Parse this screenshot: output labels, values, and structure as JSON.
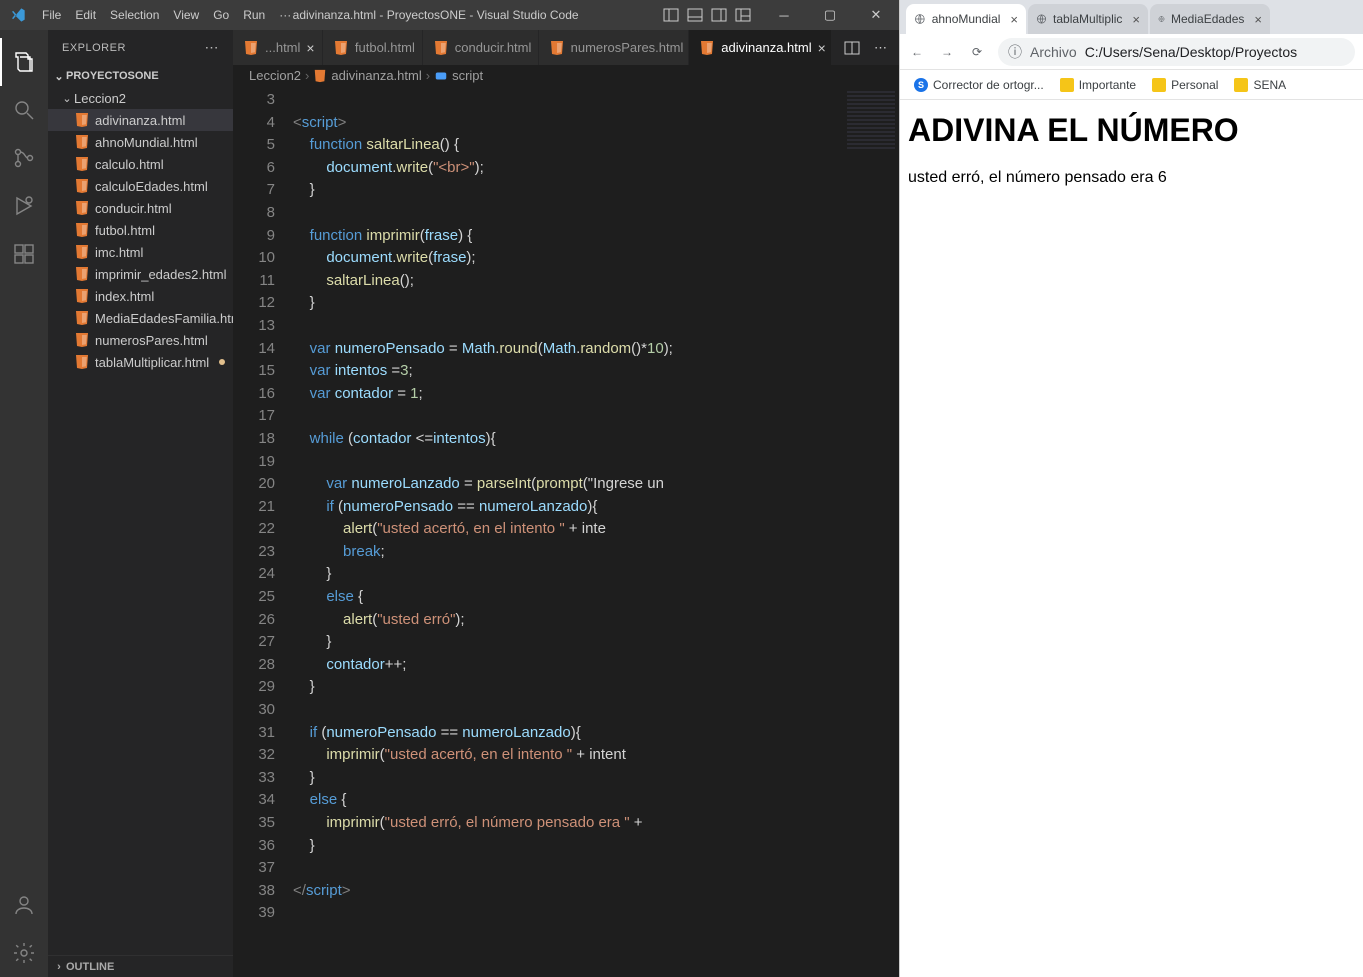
{
  "vscode": {
    "titlebar": {
      "menus": [
        "File",
        "Edit",
        "Selection",
        "View",
        "Go",
        "Run",
        "···"
      ],
      "title": "adivinanza.html - ProyectosONE - Visual Studio Code"
    },
    "sidebar": {
      "title": "EXPLORER",
      "project": "PROYECTOSONE",
      "folder": "Leccion2",
      "files": [
        {
          "name": "adivinanza.html",
          "active": true,
          "mod": false
        },
        {
          "name": "ahnoMundial.html",
          "active": false,
          "mod": false
        },
        {
          "name": "calculo.html",
          "active": false,
          "mod": false
        },
        {
          "name": "calculoEdades.html",
          "active": false,
          "mod": false
        },
        {
          "name": "conducir.html",
          "active": false,
          "mod": false
        },
        {
          "name": "futbol.html",
          "active": false,
          "mod": false
        },
        {
          "name": "imc.html",
          "active": false,
          "mod": false
        },
        {
          "name": "imprimir_edades2.html",
          "active": false,
          "mod": false
        },
        {
          "name": "index.html",
          "active": false,
          "mod": false
        },
        {
          "name": "MediaEdadesFamilia.html",
          "active": false,
          "mod": false
        },
        {
          "name": "numerosPares.html",
          "active": false,
          "mod": false
        },
        {
          "name": "tablaMultiplicar.html",
          "active": false,
          "mod": true
        }
      ],
      "outline": "OUTLINE"
    },
    "tabs": [
      {
        "name": "html",
        "suffix": "",
        "close": true,
        "active": false,
        "partial": true
      },
      {
        "name": "futbol.html",
        "active": false
      },
      {
        "name": "conducir.html",
        "active": false
      },
      {
        "name": "numerosPares.html",
        "active": false
      },
      {
        "name": "adivinanza.html",
        "active": true,
        "close": true
      }
    ],
    "breadcrumbs": [
      "Leccion2",
      "adivinanza.html",
      "script"
    ],
    "linestart": 3,
    "code": [
      "",
      "<script>",
      "    function saltarLinea() {",
      "        document.write(\"<br>\");",
      "    }",
      "",
      "    function imprimir(frase) {",
      "        document.write(frase);",
      "        saltarLinea();",
      "    }",
      "",
      "    var numeroPensado = Math.round(Math.random()*10);",
      "    var intentos =3;",
      "    var contador = 1;",
      "",
      "    while (contador <=intentos){",
      "",
      "        var numeroLanzado = parseInt(prompt(\"Ingrese un",
      "        if (numeroPensado == numeroLanzado){",
      "            alert(\"usted acertó, en el intento \" + inte",
      "            break;",
      "        }",
      "        else {",
      "            alert(\"usted erró\");",
      "        }",
      "        contador++;",
      "    }",
      "",
      "    if (numeroPensado == numeroLanzado){",
      "        imprimir(\"usted acertó, en el intento \" + intent",
      "    }",
      "    else {",
      "        imprimir(\"usted erró, el número pensado era \" + ",
      "    }",
      "",
      "</script>",
      ""
    ]
  },
  "browser": {
    "tabs": [
      {
        "title": "ahnoMundial",
        "active": true
      },
      {
        "title": "tablaMultiplic",
        "active": false
      },
      {
        "title": "MediaEdades",
        "active": false
      }
    ],
    "address_prefix": "Archivo",
    "address": "C:/Users/Sena/Desktop/Proyectos",
    "bookmarks": [
      {
        "label": "Corrector de ortogr...",
        "icon": "S"
      },
      {
        "label": "Importante",
        "icon": "folder"
      },
      {
        "label": "Personal",
        "icon": "folder"
      },
      {
        "label": "SENA",
        "icon": "folder"
      }
    ],
    "page": {
      "heading": "ADIVINA EL NÚMERO",
      "text": "usted erró, el número pensado era 6"
    }
  }
}
